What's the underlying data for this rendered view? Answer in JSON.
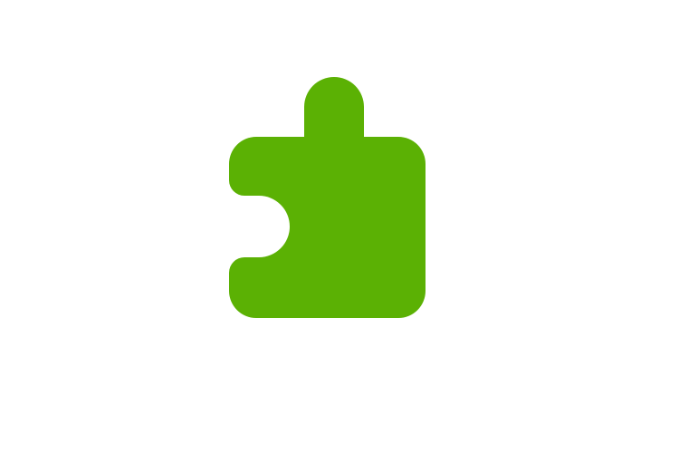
{
  "icon": {
    "name": "puzzle-piece-icon",
    "color": "#5bb104",
    "background": "#ffffff"
  }
}
